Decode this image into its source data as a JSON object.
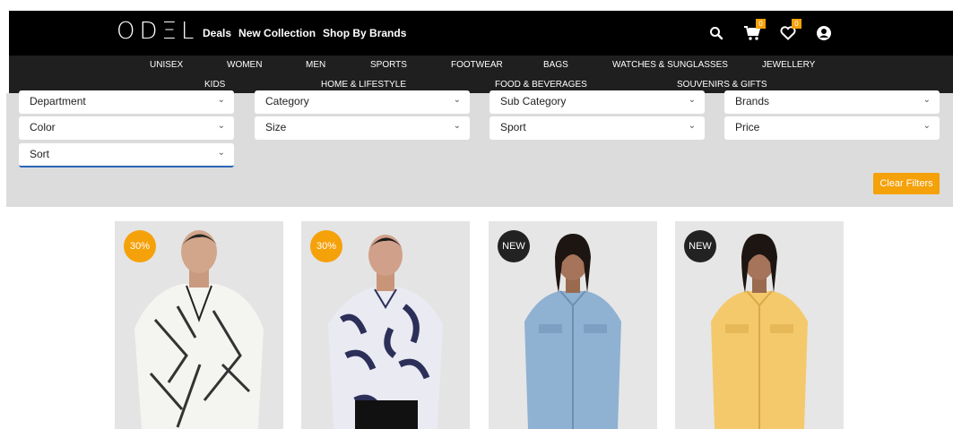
{
  "header": {
    "logo_text": "ODΞL",
    "nav": [
      "Deals",
      "New Collection",
      "Shop By Brands"
    ],
    "cart_count": "0",
    "wishlist_count": "0"
  },
  "categories": {
    "row1": [
      "UNISEX",
      "WOMEN",
      "MEN",
      "SPORTS",
      "FOOTWEAR",
      "BAGS",
      "WATCHES & SUNGLASSES",
      "JEWELLERY"
    ],
    "row2": [
      "KIDS",
      "HOME & LIFESTYLE",
      "FOOD & BEVERAGES",
      "SOUVENIRS & GIFTS"
    ]
  },
  "filters": {
    "department": "Department",
    "category": "Category",
    "sub_category": "Sub Category",
    "brands": "Brands",
    "color": "Color",
    "size": "Size",
    "sport": "Sport",
    "price": "Price",
    "sort": "Sort",
    "chevron": "⌄",
    "clear": "Clear Filters"
  },
  "products": [
    {
      "tag": "30%",
      "tag_color": "#f5a10a"
    },
    {
      "tag": "30%",
      "tag_color": "#f5a10a"
    },
    {
      "tag": "NEW",
      "tag_color": "#222222"
    },
    {
      "tag": "NEW",
      "tag_color": "#222222"
    }
  ],
  "icons": {
    "search": "search-icon",
    "cart": "cart-icon",
    "wishlist": "heart-icon",
    "account": "user-icon"
  },
  "colors": {
    "accent": "#f5a10a",
    "header_bg": "#000000",
    "catnav_bg": "#1f1f1f",
    "filter_bg": "#dcdcdc"
  }
}
